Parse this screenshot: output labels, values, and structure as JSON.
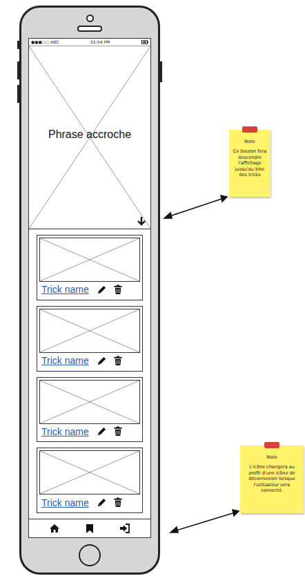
{
  "status_bar": {
    "carrier": "●●●○○ ABC",
    "time": "01:54 PM"
  },
  "hero": {
    "tagline": "Phrase accroche"
  },
  "tricks": [
    {
      "name": "Trick name"
    },
    {
      "name": "Trick name"
    },
    {
      "name": "Trick name"
    },
    {
      "name": "Trick name"
    }
  ],
  "notes": [
    {
      "title": "Note",
      "text": "Ce bouton fera descendre l'affichage jusqu'au bloc des tricks"
    },
    {
      "title": "Note",
      "text": "L'icône changera au profit d'une icône de déconnexion lorsque l'utilisateur sera connecté."
    }
  ]
}
